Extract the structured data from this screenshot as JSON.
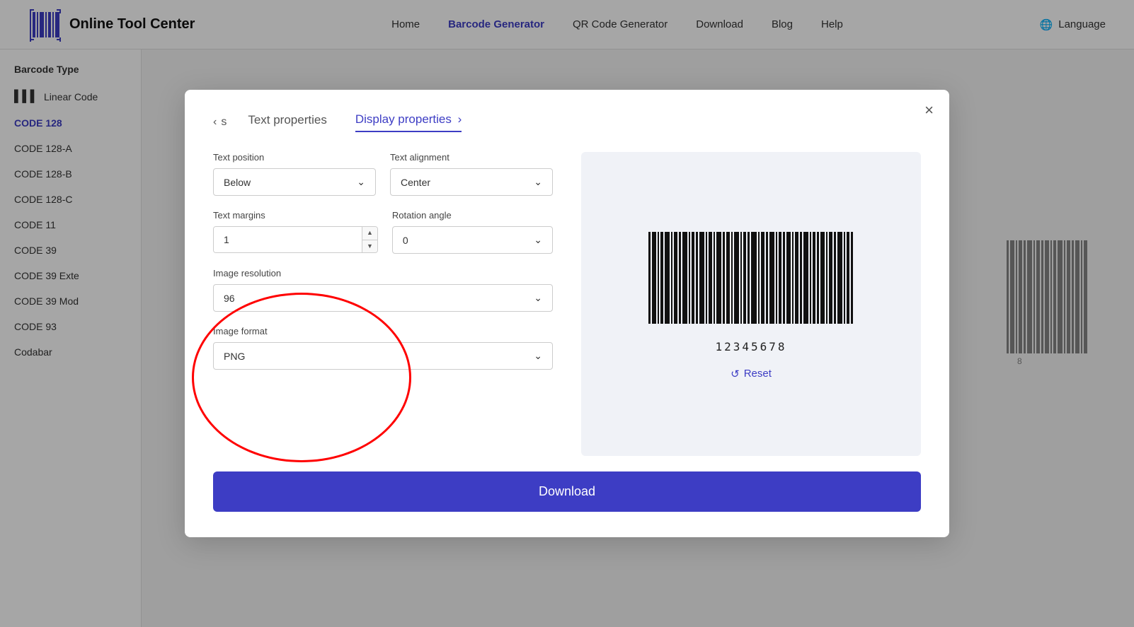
{
  "navbar": {
    "logo_text": "Online Tool Center",
    "links": [
      {
        "label": "Home",
        "active": false
      },
      {
        "label": "Barcode Generator",
        "active": true
      },
      {
        "label": "QR Code Generator",
        "active": false
      },
      {
        "label": "Download",
        "active": false
      },
      {
        "label": "Blog",
        "active": false
      },
      {
        "label": "Help",
        "active": false
      }
    ],
    "language_label": "Language"
  },
  "sidebar": {
    "title": "Barcode Type",
    "items": [
      {
        "label": "Linear Code",
        "active": false,
        "icon": "|||"
      },
      {
        "label": "CODE 128",
        "active": true
      },
      {
        "label": "CODE 128-A",
        "active": false
      },
      {
        "label": "CODE 128-B",
        "active": false
      },
      {
        "label": "CODE 128-C",
        "active": false
      },
      {
        "label": "CODE 11",
        "active": false
      },
      {
        "label": "CODE 39",
        "active": false
      },
      {
        "label": "CODE 39 Exte",
        "active": false
      },
      {
        "label": "CODE 39 Mod",
        "active": false
      },
      {
        "label": "CODE 93",
        "active": false
      },
      {
        "label": "Codabar",
        "active": false
      }
    ]
  },
  "modal": {
    "tab_prev_label": "s",
    "tab_text_properties": "Text properties",
    "tab_display_properties": "Display properties",
    "close_label": "×",
    "form": {
      "text_position_label": "Text position",
      "text_position_value": "Below",
      "text_alignment_label": "Text alignment",
      "text_alignment_value": "Center",
      "text_margins_label": "Text margins",
      "text_margins_value": "1",
      "rotation_angle_label": "Rotation angle",
      "rotation_angle_value": "0",
      "image_resolution_label": "Image resolution",
      "image_resolution_value": "96",
      "image_format_label": "Image format",
      "image_format_value": "PNG"
    },
    "preview": {
      "barcode_number": "12345678",
      "reset_label": "Reset"
    },
    "download_label": "Download"
  },
  "icons": {
    "chevron_left": "‹",
    "chevron_right": "›",
    "chevron_down": "⌄",
    "close": "×",
    "reset": "↺",
    "globe": "🌐",
    "copy": "⧉",
    "barcode": "|||"
  }
}
